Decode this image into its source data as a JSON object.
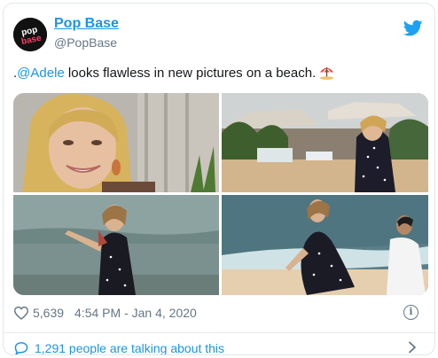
{
  "tweet": {
    "display_name": "Pop Base",
    "handle": "@PopBase",
    "text_prefix": ".",
    "mention": "@Adele",
    "text_body": " looks flawless in new pictures on a beach.",
    "emoji": "beach-umbrella",
    "likes": "5,639",
    "timestamp": "4:54 PM - Jan 4, 2020",
    "talking": "1,291 people are talking about this"
  },
  "avatar": {
    "logo_text": "pop base"
  },
  "icons": {
    "twitter": "twitter-bird-icon",
    "like": "heart-icon",
    "info": "info-icon",
    "reply": "speech-bubble-icon",
    "chevron": "chevron-right-icon"
  },
  "colors": {
    "link": "#1b95e0",
    "text": "#14171a",
    "muted": "#657786",
    "border": "#e1e8ed"
  },
  "photos": [
    {
      "alt": "portrait-close-up"
    },
    {
      "alt": "beach-bar-scene"
    },
    {
      "alt": "sea-walk"
    },
    {
      "alt": "shoreline-bend"
    }
  ]
}
